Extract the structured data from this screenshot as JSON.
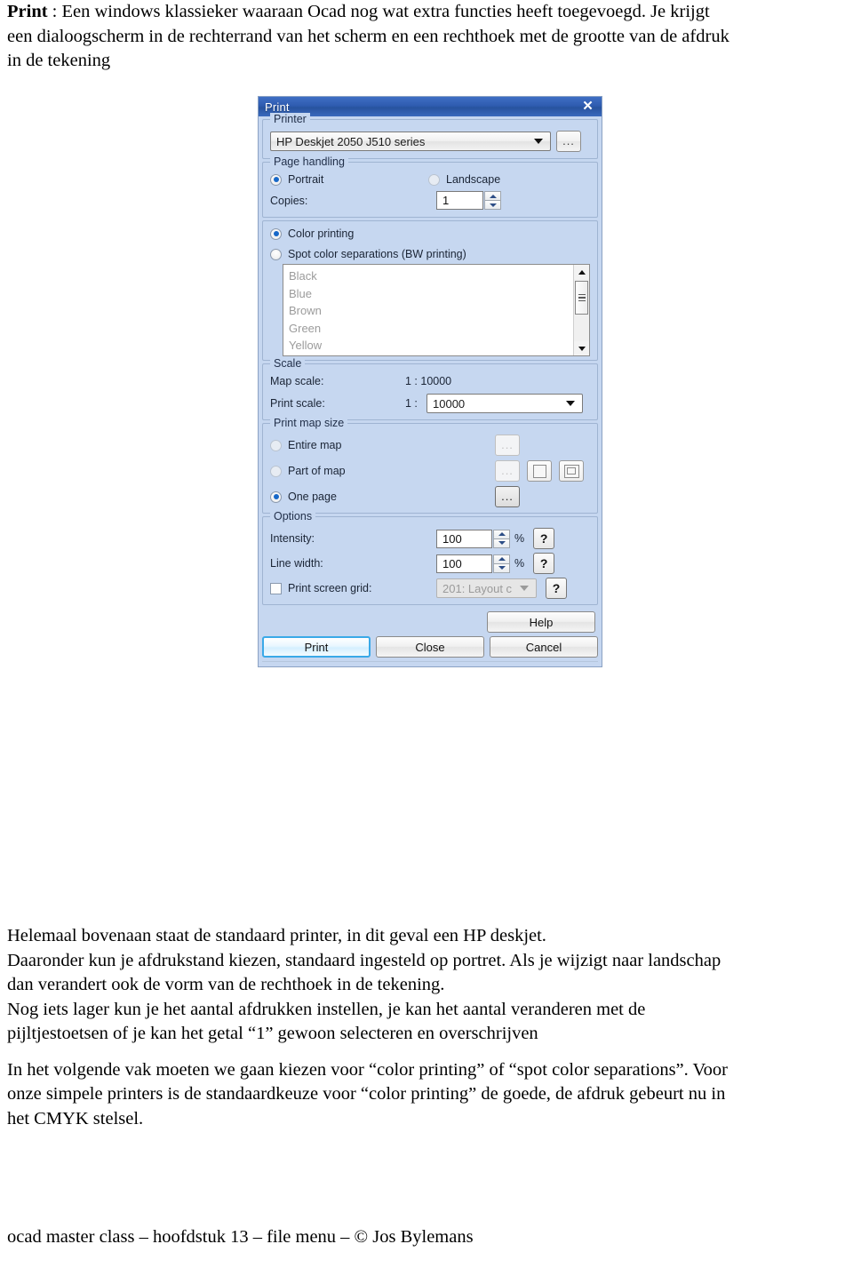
{
  "intro": {
    "lead_bold": "Print",
    "line1_rest": " : Een windows klassieker waaraan Ocad nog wat extra functies heeft toegevoegd. Je krijgt",
    "line2": "een dialoogscherm in de rechterrand van het scherm en een rechthoek met de grootte van de afdruk",
    "line3": "in de tekening"
  },
  "dialog": {
    "title": "Print",
    "close_icon": "close-icon",
    "printer": {
      "legend": "Printer",
      "selected": "HP Deskjet 2050 J510 series",
      "browse_label": "...",
      "caret_icon": "chevron-down-icon"
    },
    "page_handling": {
      "legend": "Page handling",
      "portrait_label": "Portrait",
      "landscape_label": "Landscape",
      "orientation_selected": "Portrait",
      "copies_label": "Copies:",
      "copies_value": "1",
      "spin_up_icon": "triangle-up-icon",
      "spin_down_icon": "triangle-down-icon"
    },
    "color_mode": {
      "color_printing_label": "Color printing",
      "spot_label": "Spot color separations (BW printing)",
      "selected": "Color printing",
      "spot_colors": [
        "Black",
        "Blue",
        "Brown",
        "Green",
        "Yellow"
      ],
      "scroll_up_icon": "scroll-up-arrow-icon",
      "scroll_down_icon": "scroll-down-arrow-icon"
    },
    "scale": {
      "legend": "Scale",
      "map_scale_label": "Map scale:",
      "map_scale_value": "1 : 10000",
      "print_scale_label": "Print scale:",
      "print_scale_prefix": "1 :",
      "print_scale_value": "10000"
    },
    "print_map_size": {
      "legend": "Print map size",
      "entire_map_label": "Entire map",
      "part_of_map_label": "Part of map",
      "one_page_label": "One page",
      "selected": "One page",
      "dots_label": "...",
      "page_icon": "page-rectangle-icon",
      "page_nested_icon": "page-nested-rectangle-icon"
    },
    "options": {
      "legend": "Options",
      "intensity_label": "Intensity:",
      "intensity_value": "100",
      "intensity_unit": "%",
      "line_width_label": "Line width:",
      "line_width_value": "100",
      "line_width_unit": "%",
      "print_screen_grid_label": "Print screen grid:",
      "print_screen_grid_value": "201: Layout c",
      "print_screen_grid_checked": false,
      "help_label": "?"
    },
    "buttons": {
      "help": "Help",
      "print": "Print",
      "close": "Close",
      "cancel": "Cancel",
      "default_button": "Print"
    },
    "colors": {
      "dialog_background": "#c6d7f0",
      "titlebar_blue": "#2f5cb0",
      "radio_dot": "#1768c8",
      "default_button_focus": "#3aa9e8",
      "disabled_text": "#9b9b9b"
    }
  },
  "body": {
    "p1_l1": "Helemaal bovenaan staat de standaard printer, in dit geval een HP deskjet.",
    "p1_l2": "Daaronder kun je afdrukstand kiezen, standaard ingesteld op portret. Als je wijzigt naar landschap",
    "p1_l3": "dan verandert ook de vorm van de rechthoek in de tekening.",
    "p1_l4": "Nog iets lager kun je het aantal afdrukken instellen, je kan het aantal veranderen met de",
    "p1_l5": "pijltjestoetsen of je kan het getal “1” gewoon selecteren en overschrijven",
    "p2_l1": "In het volgende vak moeten we gaan kiezen voor “color printing” of  “spot color separations”. Voor",
    "p2_l2": "onze simpele printers is de standaardkeuze voor “color printing” de goede, de afdruk gebeurt nu in",
    "p2_l3": "het CMYK stelsel."
  },
  "footer": {
    "text": "ocad master class – hoofdstuk 13 – file menu – © Jos Bylemans"
  }
}
